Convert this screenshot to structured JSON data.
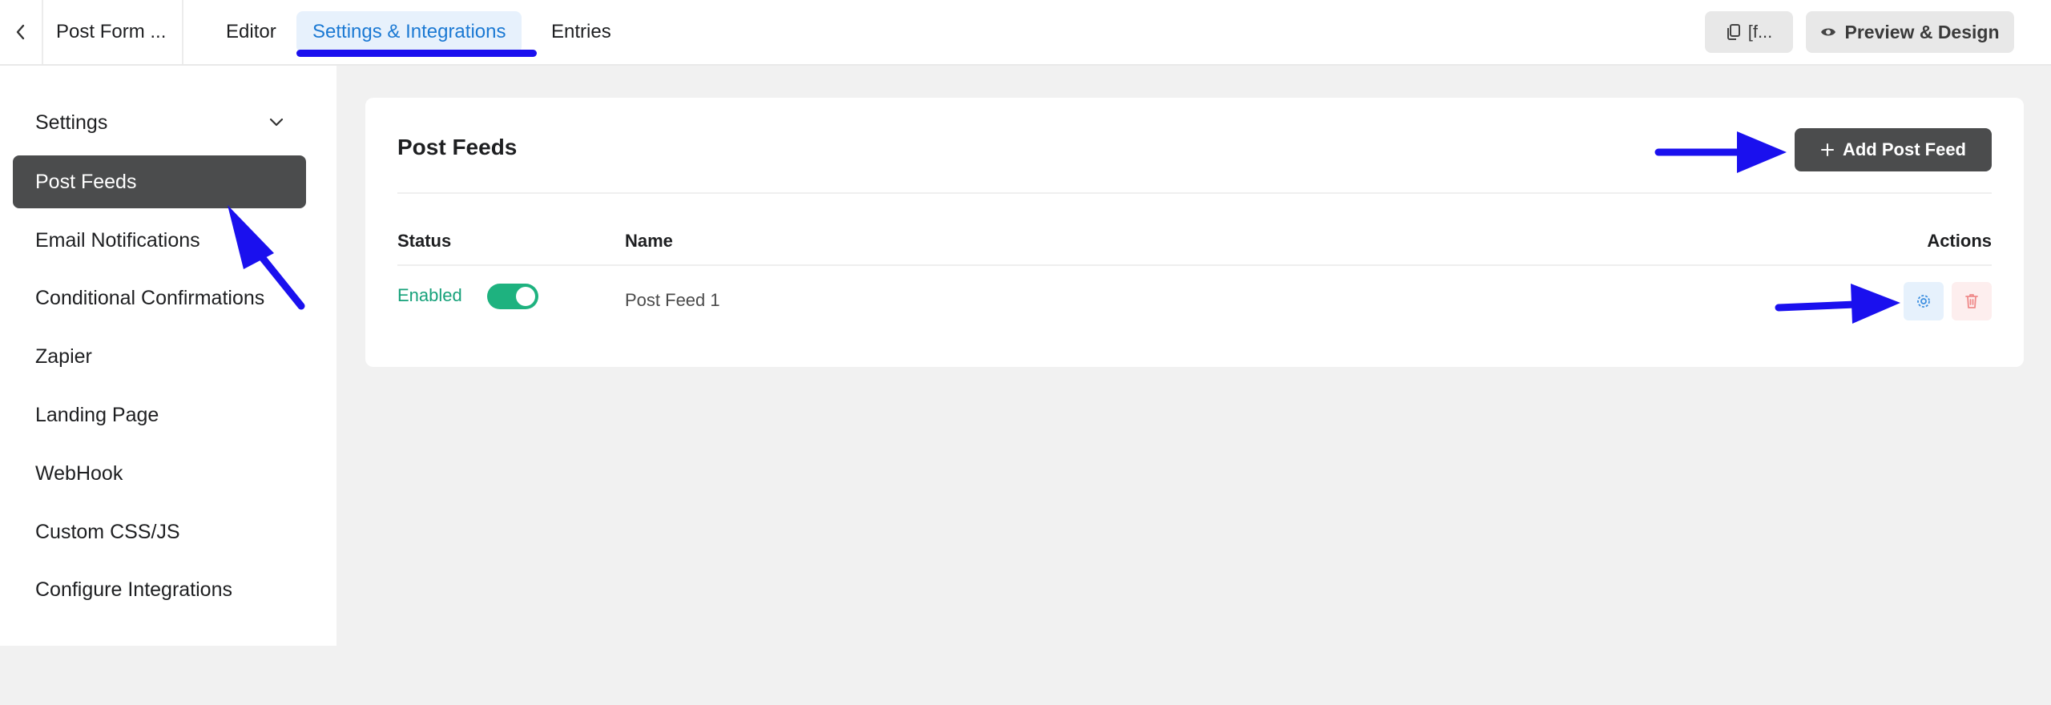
{
  "header": {
    "form_title": "Post Form ...",
    "tabs": [
      {
        "label": "Editor",
        "active": false
      },
      {
        "label": "Settings & Integrations",
        "active": true
      },
      {
        "label": "Entries",
        "active": false
      }
    ],
    "shortcode_label": "[f...",
    "preview_label": "Preview & Design"
  },
  "sidebar": {
    "items": [
      {
        "label": "Settings",
        "active": false,
        "expandable": true
      },
      {
        "label": "Post Feeds",
        "active": true
      },
      {
        "label": "Email Notifications",
        "active": false
      },
      {
        "label": "Conditional Confirmations",
        "active": false
      },
      {
        "label": "Zapier",
        "active": false
      },
      {
        "label": "Landing Page",
        "active": false
      },
      {
        "label": "WebHook",
        "active": false
      },
      {
        "label": "Custom CSS/JS",
        "active": false
      },
      {
        "label": "Configure Integrations",
        "active": false
      }
    ]
  },
  "main": {
    "title": "Post Feeds",
    "add_button_label": "Add Post Feed",
    "table": {
      "columns": [
        "Status",
        "Name",
        "Actions"
      ],
      "rows": [
        {
          "status": "Enabled",
          "enabled": true,
          "name": "Post Feed 1"
        }
      ]
    }
  },
  "colors": {
    "accent_blue": "#1b79d3",
    "active_bg": "#4b4c4d",
    "enabled_green": "#1eb27f",
    "annotation_blue": "#1a10ee"
  }
}
